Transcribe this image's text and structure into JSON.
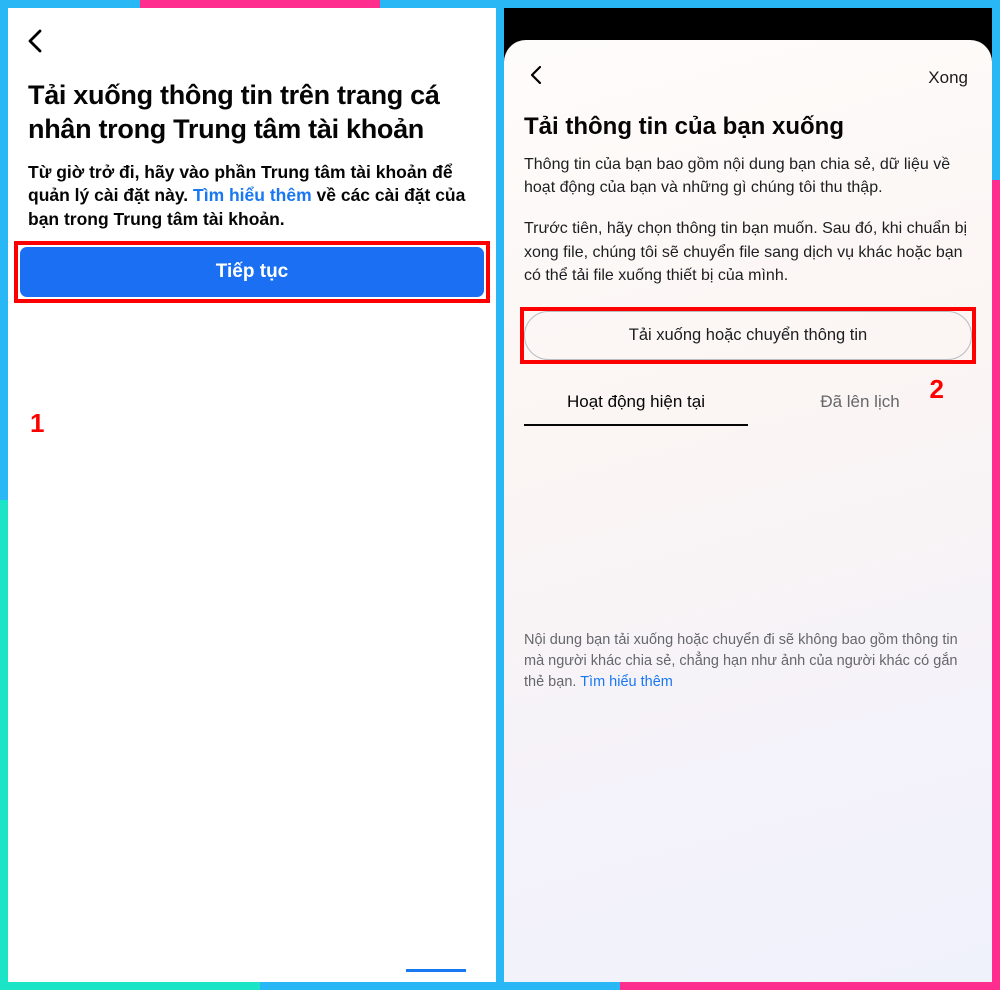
{
  "annotations": {
    "marker1": "1",
    "marker2": "2"
  },
  "left": {
    "title": "Tải xuống thông tin trên trang cá nhân trong Trung tâm tài khoản",
    "desc_part1": "Từ giờ trở đi, hãy vào phần Trung tâm tài khoản để quản lý cài đặt này. ",
    "desc_link": "Tìm hiểu thêm",
    "desc_part2": " về các cài đặt của bạn trong Trung tâm tài khoản.",
    "continue_label": "Tiếp tục"
  },
  "right": {
    "done_label": "Xong",
    "title": "Tải thông tin của bạn xuống",
    "p1": "Thông tin của bạn bao gồm nội dung bạn chia sẻ, dữ liệu về hoạt động của bạn và những gì chúng tôi thu thập.",
    "p2": "Trước tiên, hãy chọn thông tin bạn muốn. Sau đó, khi chuẩn bị xong file, chúng tôi sẽ chuyển file sang dịch vụ khác hoặc bạn có thể tải file xuống thiết bị của mình.",
    "action_label": "Tải xuống hoặc chuyển thông tin",
    "tabs": {
      "active": "Hoạt động hiện tại",
      "scheduled": "Đã lên lịch"
    },
    "footer_part1": "Nội dung bạn tải xuống hoặc chuyển đi sẽ không bao gồm thông tin mà người khác chia sẻ, chẳng hạn như ảnh của người khác có gắn thẻ bạn. ",
    "footer_link": "Tìm hiểu thêm"
  }
}
